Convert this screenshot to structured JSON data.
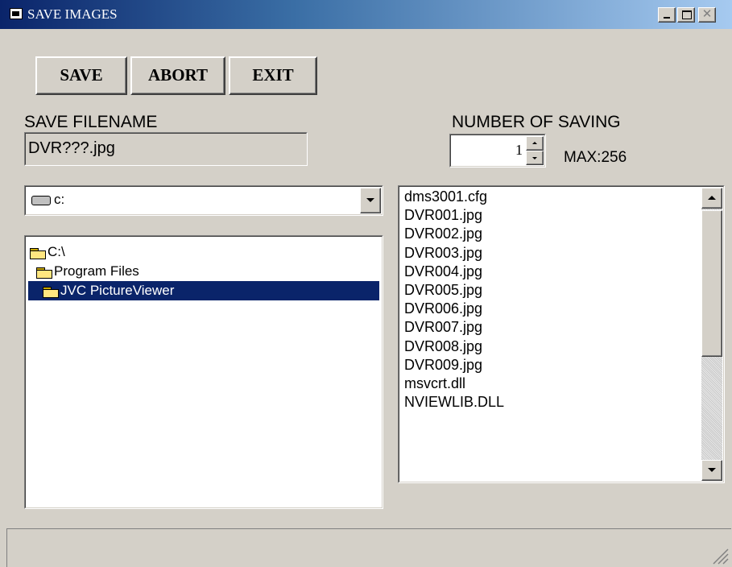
{
  "window": {
    "title": "SAVE IMAGES"
  },
  "toolbar": {
    "save_label": "SAVE",
    "abort_label": "ABORT",
    "exit_label": "EXIT"
  },
  "filename": {
    "label": "SAVE FILENAME",
    "value": "DVR???.jpg"
  },
  "saving": {
    "label": "NUMBER OF SAVING",
    "value": "1",
    "max_label": "MAX:256"
  },
  "drive": {
    "selected": "c:"
  },
  "folders": [
    {
      "label": "C:\\"
    },
    {
      "label": "Program Files"
    },
    {
      "label": "JVC PictureViewer",
      "selected": true
    }
  ],
  "files": [
    "dms3001.cfg",
    "DVR001.jpg",
    "DVR002.jpg",
    "DVR003.jpg",
    "DVR004.jpg",
    "DVR005.jpg",
    "DVR006.jpg",
    "DVR007.jpg",
    "DVR008.jpg",
    "DVR009.jpg",
    "msvcrt.dll",
    "NVIEWLIB.DLL"
  ],
  "colors": {
    "selection": "#0a246a",
    "face": "#d4d0c8"
  }
}
